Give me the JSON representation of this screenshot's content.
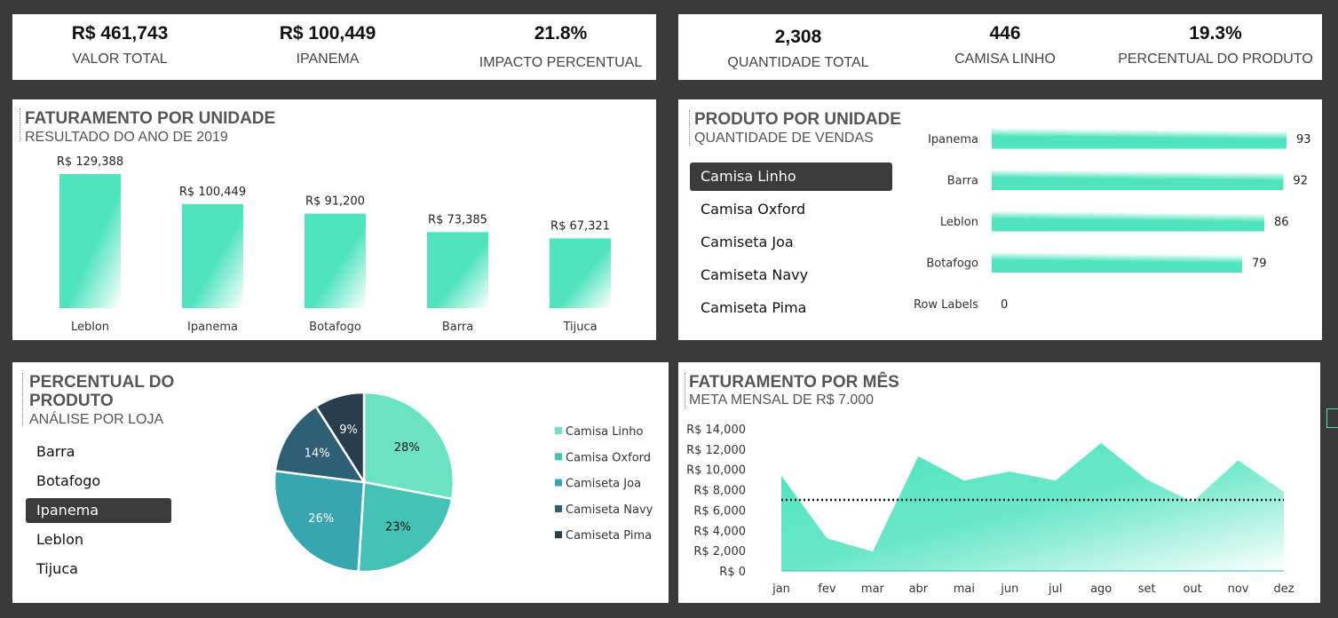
{
  "kpi_left": {
    "items": [
      {
        "value": "R$ 461,743",
        "label": "VALOR TOTAL"
      },
      {
        "value": "R$ 100,449",
        "label": "IPANEMA"
      },
      {
        "value": "21.8%",
        "label": "IMPACTO PERCENTUAL"
      }
    ]
  },
  "kpi_right": {
    "items": [
      {
        "value": "2,308",
        "label": "QUANTIDADE TOTAL"
      },
      {
        "value": "446",
        "label": "CAMISA LINHO"
      },
      {
        "value": "19.3%",
        "label": "PERCENTUAL DO PRODUTO"
      }
    ]
  },
  "faturamento_unidade": {
    "title": "FATURAMENTO POR UNIDADE",
    "subtitle": "RESULTADO DO ANO DE 2019"
  },
  "produto_unidade": {
    "title": "PRODUTO POR UNIDADE",
    "subtitle": "QUANTIDADE DE VENDAS",
    "slicer": [
      "Camisa Linho",
      "Camisa Oxford",
      "Camiseta Joa",
      "Camiseta Navy",
      "Camiseta Pima"
    ],
    "slicer_selected": "Camisa Linho"
  },
  "percentual_produto": {
    "title_line1": "PERCENTUAL DO",
    "title_line2": "PRODUTO",
    "subtitle": "ANÁLISE POR LOJA",
    "slicer": [
      "Barra",
      "Botafogo",
      "Ipanema",
      "Leblon",
      "Tijuca"
    ],
    "slicer_selected": "Ipanema"
  },
  "faturamento_mes": {
    "title": "FATURAMENTO POR MÊS",
    "subtitle": "META MENSAL DE R$ 7.000"
  },
  "colors": {
    "accent": "#4fe3be",
    "dark_card": "#3b3b3b",
    "pie": [
      "#6be3c2",
      "#43c2b5",
      "#38a6b0",
      "#2e5f74",
      "#283d50"
    ]
  },
  "chart_data": [
    {
      "id": "faturamento-por-unidade",
      "type": "bar",
      "categories": [
        "Leblon",
        "Ipanema",
        "Botafogo",
        "Barra",
        "Tijuca"
      ],
      "values": [
        129388,
        100449,
        91200,
        73385,
        67321
      ],
      "data_labels": [
        "R$ 129,388",
        "R$ 100,449",
        "R$ 91,200",
        "R$ 73,385",
        "R$ 67,321"
      ],
      "ylim": [
        0,
        129388
      ]
    },
    {
      "id": "produto-por-unidade",
      "type": "bar",
      "orientation": "horizontal",
      "categories": [
        "Ipanema",
        "Barra",
        "Leblon",
        "Botafogo",
        "Row Labels"
      ],
      "values": [
        93,
        92,
        86,
        79,
        0
      ],
      "xlim": [
        0,
        93
      ]
    },
    {
      "id": "percentual-do-produto",
      "type": "pie",
      "categories": [
        "Camisa Linho",
        "Camisa Oxford",
        "Camiseta Joa",
        "Camiseta Navy",
        "Camiseta Pima"
      ],
      "values": [
        28,
        23,
        26,
        14,
        9
      ],
      "data_labels": [
        "28%",
        "23%",
        "26%",
        "14%",
        "9%"
      ],
      "legend": "right"
    },
    {
      "id": "faturamento-por-mes",
      "type": "area",
      "x": [
        "jan",
        "fev",
        "mar",
        "abr",
        "mai",
        "jun",
        "jul",
        "ago",
        "set",
        "out",
        "nov",
        "dez"
      ],
      "values": [
        9400,
        3200,
        1900,
        11300,
        8900,
        9800,
        8900,
        12600,
        9000,
        6800,
        10900,
        7800
      ],
      "target": 7000,
      "yticks": [
        "R$ 0",
        "R$ 2,000",
        "R$ 4,000",
        "R$ 6,000",
        "R$ 8,000",
        "R$ 10,000",
        "R$ 12,000",
        "R$ 14,000"
      ],
      "ylim": [
        0,
        14000
      ]
    }
  ]
}
